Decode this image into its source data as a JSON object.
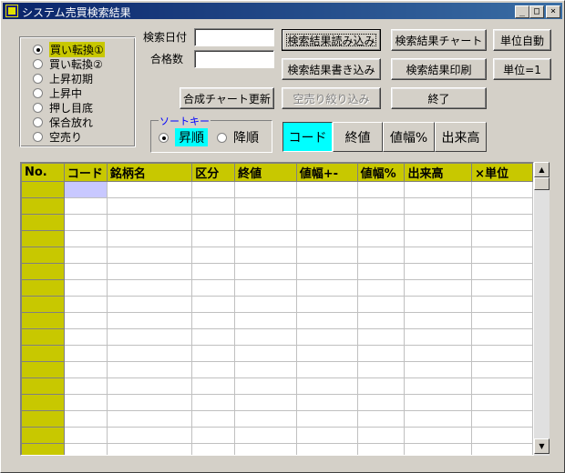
{
  "window": {
    "title": "システム売買検索結果",
    "minimize_glyph": "_",
    "maximize_glyph": "□",
    "close_glyph": "×"
  },
  "screen_radio": {
    "options": [
      "買い転換①",
      "買い転換②",
      "上昇初期",
      "上昇中",
      "押し目底",
      "保合放れ",
      "空売り"
    ],
    "selected_index": 0
  },
  "search": {
    "date_label": "検索日付",
    "date_value": "",
    "passed_label": "合格数",
    "passed_value": ""
  },
  "buttons": {
    "read_results": "検索結果読み込み",
    "write_results": "検索結果書き込み",
    "short_filter": "空売り絞り込み",
    "results_chart": "検索結果チャート",
    "print_results": "検索結果印刷",
    "exit": "終了",
    "unit_auto": "単位自動",
    "unit_one": "単位=1",
    "composite_chart": "合成チャート更新"
  },
  "sort_key": {
    "legend": "ソートキー",
    "ascending": "昇順",
    "descending": "降順",
    "selected": "ascending",
    "fields": [
      "コード",
      "終値",
      "値幅%",
      "出来高"
    ],
    "active_field_index": 0
  },
  "grid": {
    "columns": [
      "No.",
      "コード",
      "銘柄名",
      "区分",
      "終値",
      "値幅+-",
      "値幅%",
      "出来高",
      "×単位"
    ],
    "row_count": 17
  },
  "colors": {
    "header_bg": "#c8c800",
    "active_sort": "#00ffff",
    "selected_cell": "#c8c8ff",
    "title_bar": "#0a246a"
  },
  "icons": {
    "scroll_up": "▲",
    "scroll_down": "▼"
  }
}
